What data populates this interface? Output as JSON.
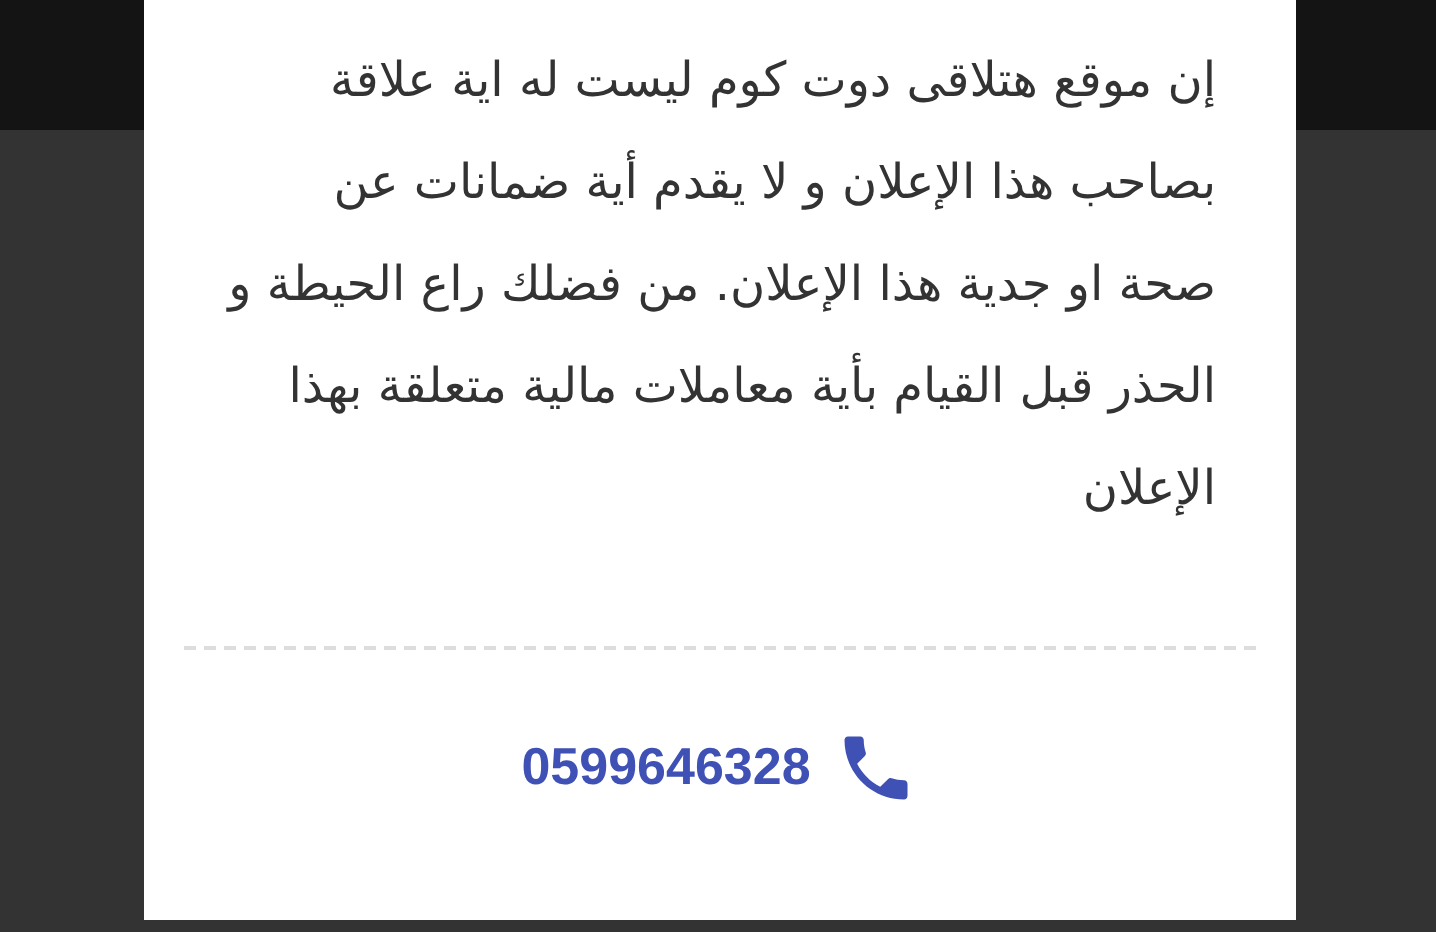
{
  "dialog": {
    "disclaimer": "إن موقع هتلاقى دوت كوم ليست له اية علاقة بصاحب هذا الإعلان و لا يقدم أية ضمانات عن صحة او جدية هذا الإعلان. من فضلك راع الحيطة و الحذر قبل القيام بأية معاملات مالية متعلقة بهذا الإعلان",
    "phone": "0599646328"
  }
}
